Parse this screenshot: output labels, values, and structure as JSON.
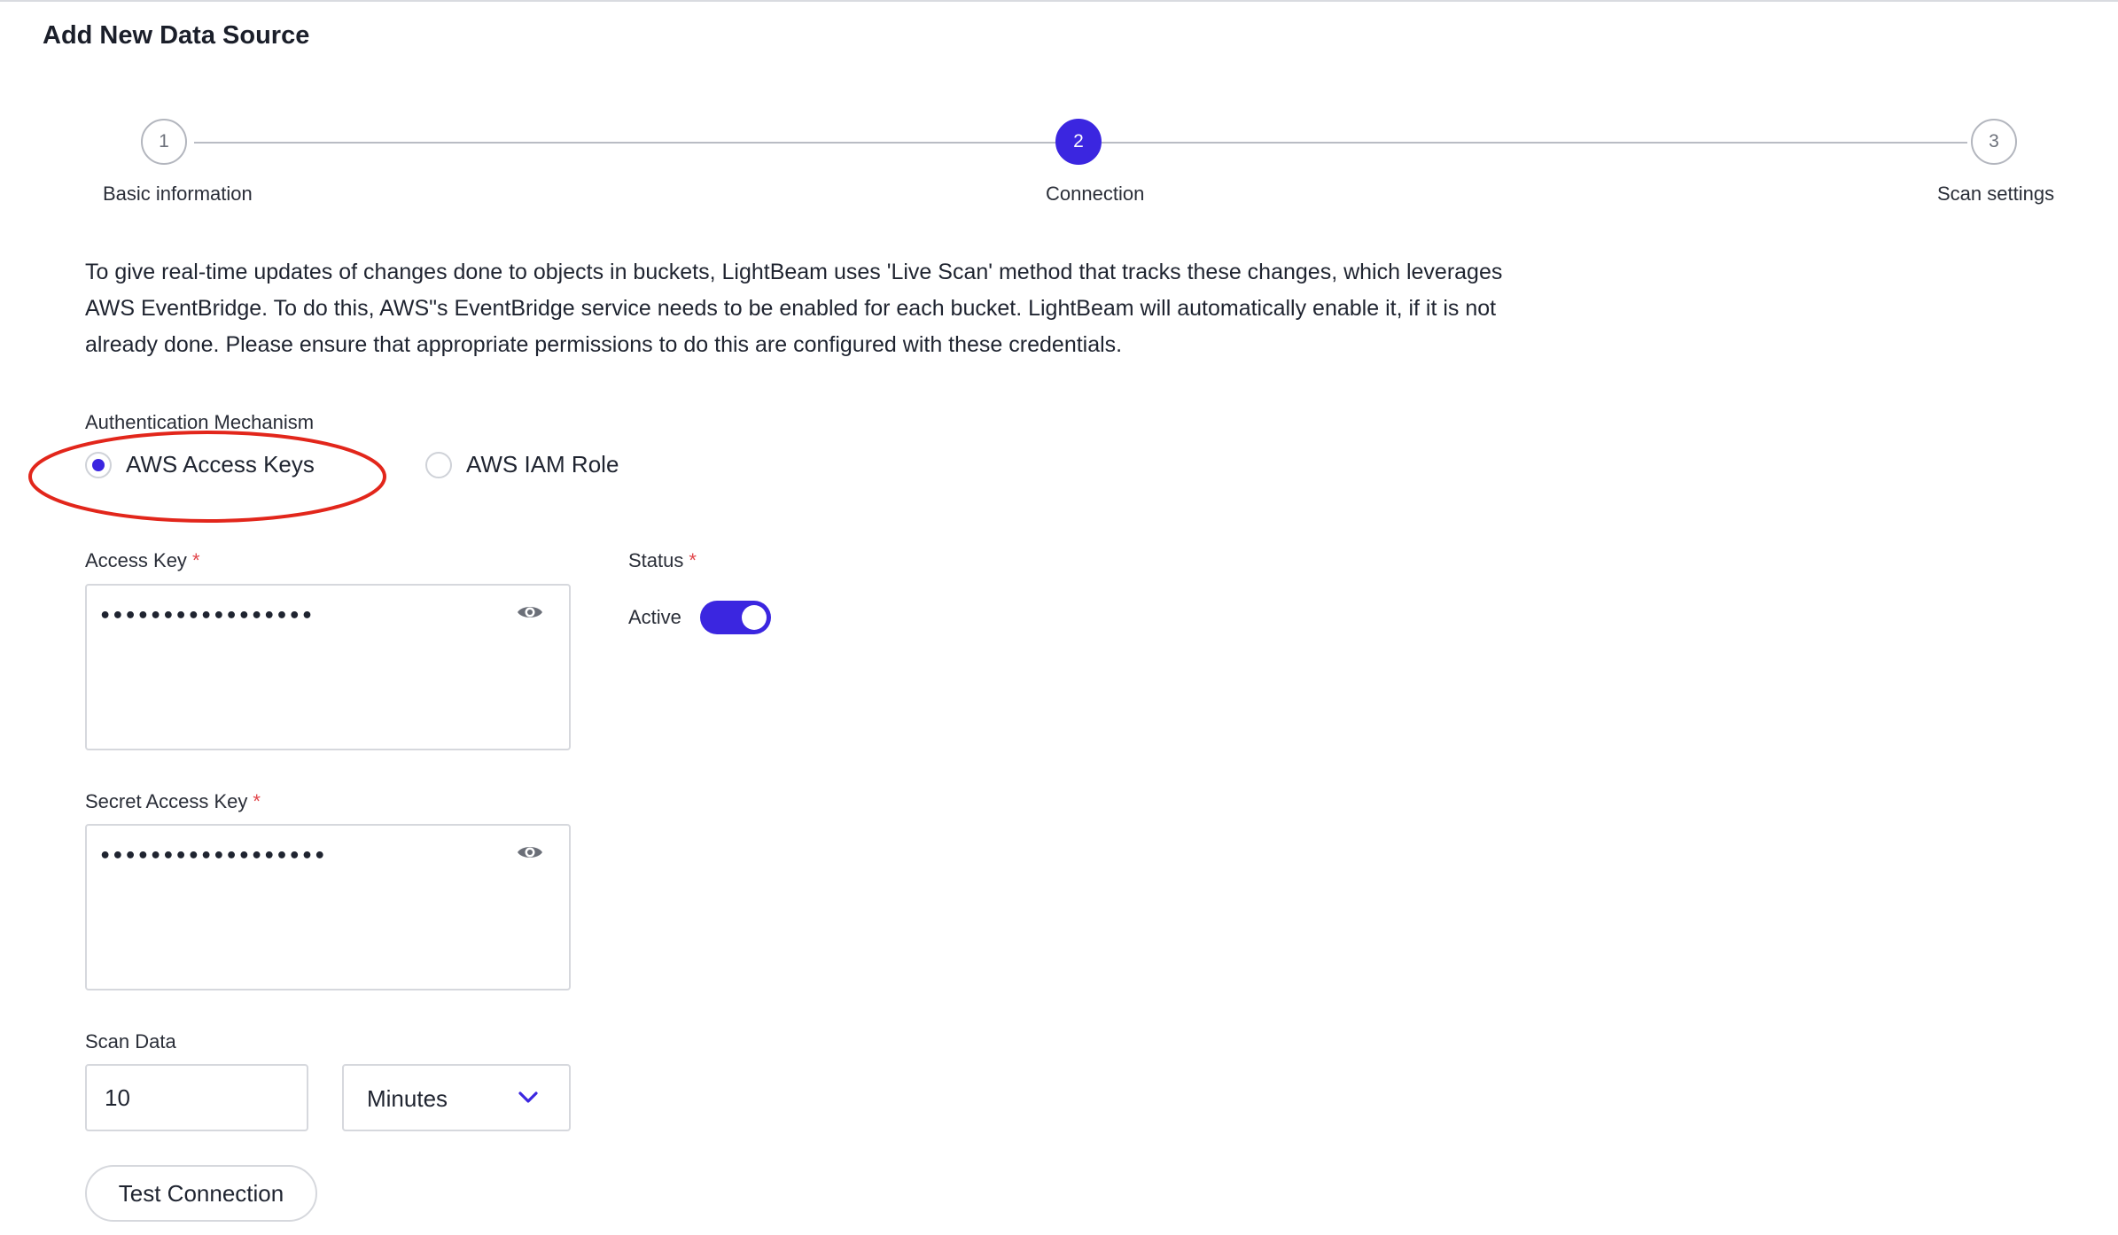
{
  "page": {
    "title": "Add New Data Source"
  },
  "stepper": {
    "steps": [
      {
        "number": "1",
        "label": "Basic information",
        "state": "inactive"
      },
      {
        "number": "2",
        "label": "Connection",
        "state": "active"
      },
      {
        "number": "3",
        "label": "Scan settings",
        "state": "inactive"
      }
    ]
  },
  "description": "To give real-time updates of changes done to objects in buckets, LightBeam uses 'Live Scan' method that tracks these changes, which leverages AWS EventBridge. To do this, AWS\"s EventBridge service needs to be enabled for each bucket. LightBeam will automatically enable it, if it is not already done. Please ensure that appropriate permissions to do this are configured with these credentials.",
  "auth": {
    "label": "Authentication Mechanism",
    "options": [
      {
        "label": "AWS Access Keys",
        "selected": true
      },
      {
        "label": "AWS IAM Role",
        "selected": false
      }
    ]
  },
  "access_key": {
    "label": "Access Key",
    "required_mark": "*",
    "value": "•••••••••••••••••",
    "icon": "eye-icon"
  },
  "secret_access_key": {
    "label": "Secret Access Key",
    "required_mark": "*",
    "value": "••••••••••••••••••",
    "icon": "eye-icon"
  },
  "status": {
    "label": "Status",
    "required_mark": "*",
    "toggle_label": "Active",
    "on": true
  },
  "scan_data": {
    "label": "Scan Data",
    "value": "10",
    "unit_selected": "Minutes",
    "icon": "chevron-down-icon"
  },
  "actions": {
    "test_connection_label": "Test Connection"
  },
  "colors": {
    "accent": "#3b26e0",
    "annotation": "#e2261b",
    "required": "#e1454a"
  }
}
